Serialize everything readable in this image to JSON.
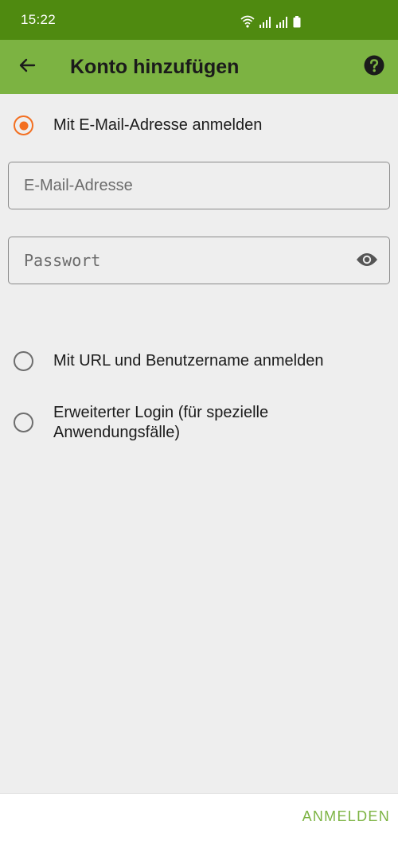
{
  "status_bar": {
    "time": "15:22"
  },
  "app_bar": {
    "title": "Konto hinzufügen",
    "back_icon": "arrow-back-icon",
    "help_icon": "help-circle-icon"
  },
  "login_options": [
    {
      "label": "Mit E-Mail-Adresse anmelden",
      "checked": true
    },
    {
      "label": "Mit URL und Benutzername anmelden",
      "checked": false
    },
    {
      "label": "Erweiterter Login (für spezielle Anwendungsfälle)",
      "checked": false
    }
  ],
  "email_field": {
    "placeholder": "E-Mail-Adresse",
    "value": ""
  },
  "password_field": {
    "placeholder": "Passwort",
    "value": "",
    "toggle_icon": "eye-icon"
  },
  "bottom_bar": {
    "submit_label": "ANMELDEN"
  },
  "colors": {
    "status_bar": "#4f8a10",
    "app_bar": "#7cb342",
    "radio_selected": "#f36f21",
    "accent_text": "#7cb342",
    "background": "#eeeeee"
  }
}
